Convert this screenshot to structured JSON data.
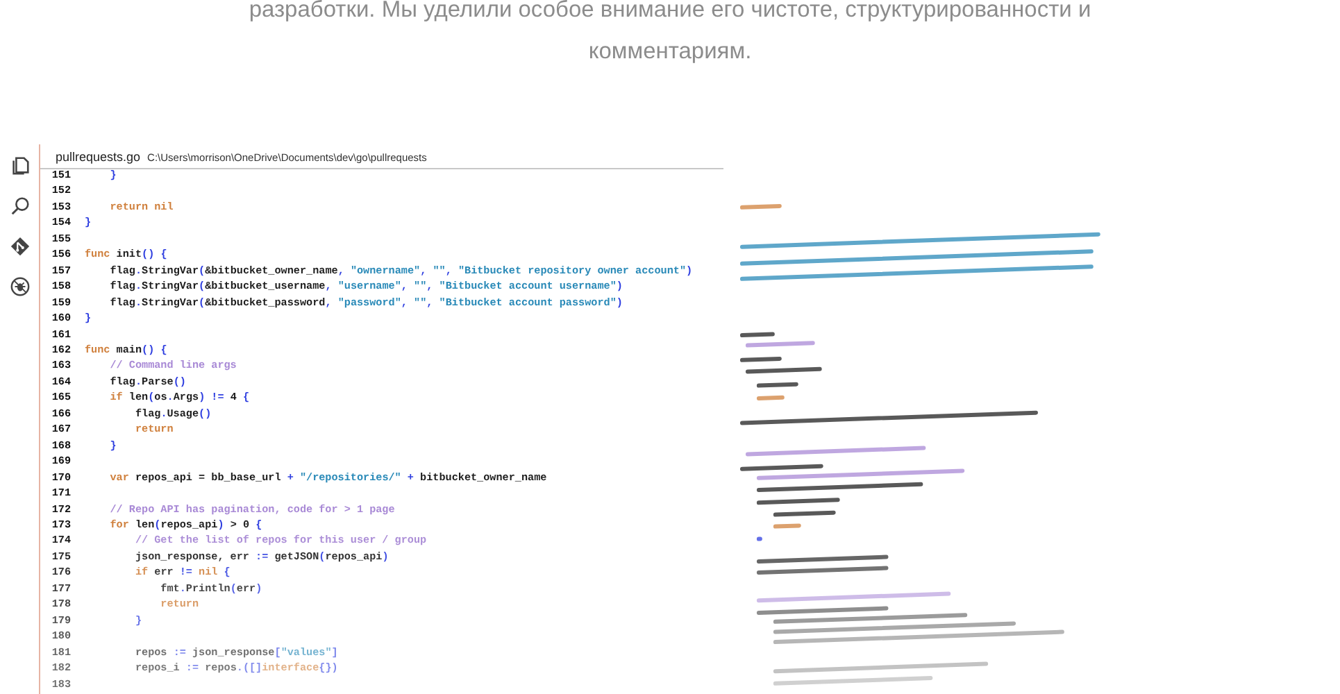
{
  "intro": {
    "text": "разработки. Мы уделили особое внимание его чистоте, структурированности и комментариям."
  },
  "activity_bar": {
    "items": [
      {
        "kind": "files"
      },
      {
        "kind": "search"
      },
      {
        "kind": "git"
      },
      {
        "kind": "debug"
      }
    ]
  },
  "editor": {
    "file_name": "pullrequests.go",
    "file_path": "C:\\Users\\morrison\\OneDrive\\Documents\\dev\\go\\pullrequests",
    "lines": [
      {
        "number": "151",
        "tokens": [
          {
            "kind": "punct",
            "text": "    }"
          }
        ]
      },
      {
        "number": "152"
      },
      {
        "number": "153",
        "tokens": [
          {
            "kind": "keyword",
            "text": "    return nil"
          }
        ]
      },
      {
        "number": "154",
        "tokens": [
          {
            "kind": "punct",
            "text": "}"
          }
        ]
      },
      {
        "number": "155"
      },
      {
        "number": "156",
        "tokens": [
          {
            "kind": "keyword",
            "text": "func"
          },
          {
            "kind": "plain",
            "text": " init"
          },
          {
            "kind": "punct",
            "text": "() {"
          }
        ]
      },
      {
        "number": "157",
        "tokens": [
          {
            "kind": "plain",
            "text": "    flag"
          },
          {
            "kind": "punct",
            "text": "."
          },
          {
            "kind": "plain",
            "text": "StringVar"
          },
          {
            "kind": "punct",
            "text": "("
          },
          {
            "kind": "plain",
            "text": "&bitbucket_owner_name"
          },
          {
            "kind": "punct",
            "text": ", "
          },
          {
            "kind": "string",
            "text": "\"ownername\""
          },
          {
            "kind": "punct",
            "text": ", "
          },
          {
            "kind": "string",
            "text": "\"\""
          },
          {
            "kind": "punct",
            "text": ", "
          },
          {
            "kind": "string",
            "text": "\"Bitbucket repository owner account\""
          },
          {
            "kind": "punct",
            "text": ")"
          }
        ]
      },
      {
        "number": "158",
        "tokens": [
          {
            "kind": "plain",
            "text": "    flag"
          },
          {
            "kind": "punct",
            "text": "."
          },
          {
            "kind": "plain",
            "text": "StringVar"
          },
          {
            "kind": "punct",
            "text": "("
          },
          {
            "kind": "plain",
            "text": "&bitbucket_username"
          },
          {
            "kind": "punct",
            "text": ", "
          },
          {
            "kind": "string",
            "text": "\"username\""
          },
          {
            "kind": "punct",
            "text": ", "
          },
          {
            "kind": "string",
            "text": "\"\""
          },
          {
            "kind": "punct",
            "text": ", "
          },
          {
            "kind": "string",
            "text": "\"Bitbucket account username\""
          },
          {
            "kind": "punct",
            "text": ")"
          }
        ]
      },
      {
        "number": "159",
        "tokens": [
          {
            "kind": "plain",
            "text": "    flag"
          },
          {
            "kind": "punct",
            "text": "."
          },
          {
            "kind": "plain",
            "text": "StringVar"
          },
          {
            "kind": "punct",
            "text": "("
          },
          {
            "kind": "plain",
            "text": "&bitbucket_password"
          },
          {
            "kind": "punct",
            "text": ", "
          },
          {
            "kind": "string",
            "text": "\"password\""
          },
          {
            "kind": "punct",
            "text": ", "
          },
          {
            "kind": "string",
            "text": "\"\""
          },
          {
            "kind": "punct",
            "text": ", "
          },
          {
            "kind": "string",
            "text": "\"Bitbucket account password\""
          },
          {
            "kind": "punct",
            "text": ")"
          }
        ]
      },
      {
        "number": "160",
        "tokens": [
          {
            "kind": "punct",
            "text": "}"
          }
        ]
      },
      {
        "number": "161"
      },
      {
        "number": "162",
        "tokens": [
          {
            "kind": "keyword",
            "text": "func"
          },
          {
            "kind": "plain",
            "text": " main"
          },
          {
            "kind": "punct",
            "text": "() {"
          }
        ]
      },
      {
        "number": "163",
        "tokens": [
          {
            "kind": "comment",
            "text": "    // Command line args"
          }
        ]
      },
      {
        "number": "164",
        "tokens": [
          {
            "kind": "plain",
            "text": "    flag"
          },
          {
            "kind": "punct",
            "text": "."
          },
          {
            "kind": "plain",
            "text": "Parse"
          },
          {
            "kind": "punct",
            "text": "()"
          }
        ]
      },
      {
        "number": "165",
        "tokens": [
          {
            "kind": "keyword",
            "text": "    if"
          },
          {
            "kind": "plain",
            "text": " len"
          },
          {
            "kind": "punct",
            "text": "("
          },
          {
            "kind": "plain",
            "text": "os"
          },
          {
            "kind": "punct",
            "text": "."
          },
          {
            "kind": "plain",
            "text": "Args"
          },
          {
            "kind": "punct",
            "text": ") !="
          },
          {
            "kind": "plain",
            "text": " 4 "
          },
          {
            "kind": "punct",
            "text": "{"
          }
        ]
      },
      {
        "number": "166",
        "tokens": [
          {
            "kind": "plain",
            "text": "        flag"
          },
          {
            "kind": "punct",
            "text": "."
          },
          {
            "kind": "plain",
            "text": "Usage"
          },
          {
            "kind": "punct",
            "text": "()"
          }
        ]
      },
      {
        "number": "167",
        "tokens": [
          {
            "kind": "keyword",
            "text": "        return"
          }
        ]
      },
      {
        "number": "168",
        "tokens": [
          {
            "kind": "punct",
            "text": "    }"
          }
        ]
      },
      {
        "number": "169"
      },
      {
        "number": "170",
        "tokens": [
          {
            "kind": "keyword",
            "text": "    var"
          },
          {
            "kind": "plain",
            "text": " repos_api = bb_base_url"
          },
          {
            "kind": "punct",
            "text": " + "
          },
          {
            "kind": "string",
            "text": "\"/repositories/\""
          },
          {
            "kind": "punct",
            "text": " + "
          },
          {
            "kind": "plain",
            "text": "bitbucket_owner_name"
          }
        ]
      },
      {
        "number": "171"
      },
      {
        "number": "172",
        "tokens": [
          {
            "kind": "comment",
            "text": "    // Repo API has pagination, code for > 1 page"
          }
        ]
      },
      {
        "number": "173",
        "tokens": [
          {
            "kind": "keyword",
            "text": "    for"
          },
          {
            "kind": "plain",
            "text": " len"
          },
          {
            "kind": "punct",
            "text": "("
          },
          {
            "kind": "plain",
            "text": "repos_api"
          },
          {
            "kind": "punct",
            "text": ")"
          },
          {
            "kind": "plain",
            "text": " > 0 "
          },
          {
            "kind": "punct",
            "text": "{"
          }
        ]
      },
      {
        "number": "174",
        "tokens": [
          {
            "kind": "comment",
            "text": "        // Get the list of repos for this user / group"
          }
        ]
      },
      {
        "number": "175",
        "tokens": [
          {
            "kind": "plain",
            "text": "        json_response, err "
          },
          {
            "kind": "punct",
            "text": ":="
          },
          {
            "kind": "plain",
            "text": " getJSON"
          },
          {
            "kind": "punct",
            "text": "("
          },
          {
            "kind": "plain",
            "text": "repos_api"
          },
          {
            "kind": "punct",
            "text": ")"
          }
        ]
      },
      {
        "number": "176",
        "tokens": [
          {
            "kind": "keyword",
            "text": "        if"
          },
          {
            "kind": "plain",
            "text": " err "
          },
          {
            "kind": "punct",
            "text": "!= "
          },
          {
            "kind": "keyword",
            "text": "nil"
          },
          {
            "kind": "punct",
            "text": " {"
          }
        ]
      },
      {
        "number": "177",
        "tokens": [
          {
            "kind": "plain",
            "text": "            fmt"
          },
          {
            "kind": "punct",
            "text": "."
          },
          {
            "kind": "plain",
            "text": "Println"
          },
          {
            "kind": "punct",
            "text": "("
          },
          {
            "kind": "plain",
            "text": "err"
          },
          {
            "kind": "punct",
            "text": ")"
          }
        ]
      },
      {
        "number": "178",
        "tokens": [
          {
            "kind": "keyword",
            "text": "            return"
          }
        ]
      },
      {
        "number": "179",
        "tokens": [
          {
            "kind": "punct",
            "text": "        }"
          }
        ]
      },
      {
        "number": "180"
      },
      {
        "number": "181",
        "tokens": [
          {
            "kind": "plain",
            "text": "        repos "
          },
          {
            "kind": "punct",
            "text": ":="
          },
          {
            "kind": "plain",
            "text": " json_response"
          },
          {
            "kind": "punct",
            "text": "["
          },
          {
            "kind": "string",
            "text": "\"values\""
          },
          {
            "kind": "punct",
            "text": "]"
          }
        ]
      },
      {
        "number": "182",
        "tokens": [
          {
            "kind": "plain",
            "text": "        repos_i "
          },
          {
            "kind": "punct",
            "text": ":="
          },
          {
            "kind": "plain",
            "text": " repos"
          },
          {
            "kind": "punct",
            "text": ".([]"
          },
          {
            "kind": "keyword",
            "text": "interface"
          },
          {
            "kind": "punct",
            "text": "{})"
          }
        ]
      },
      {
        "number": "183"
      }
    ]
  }
}
